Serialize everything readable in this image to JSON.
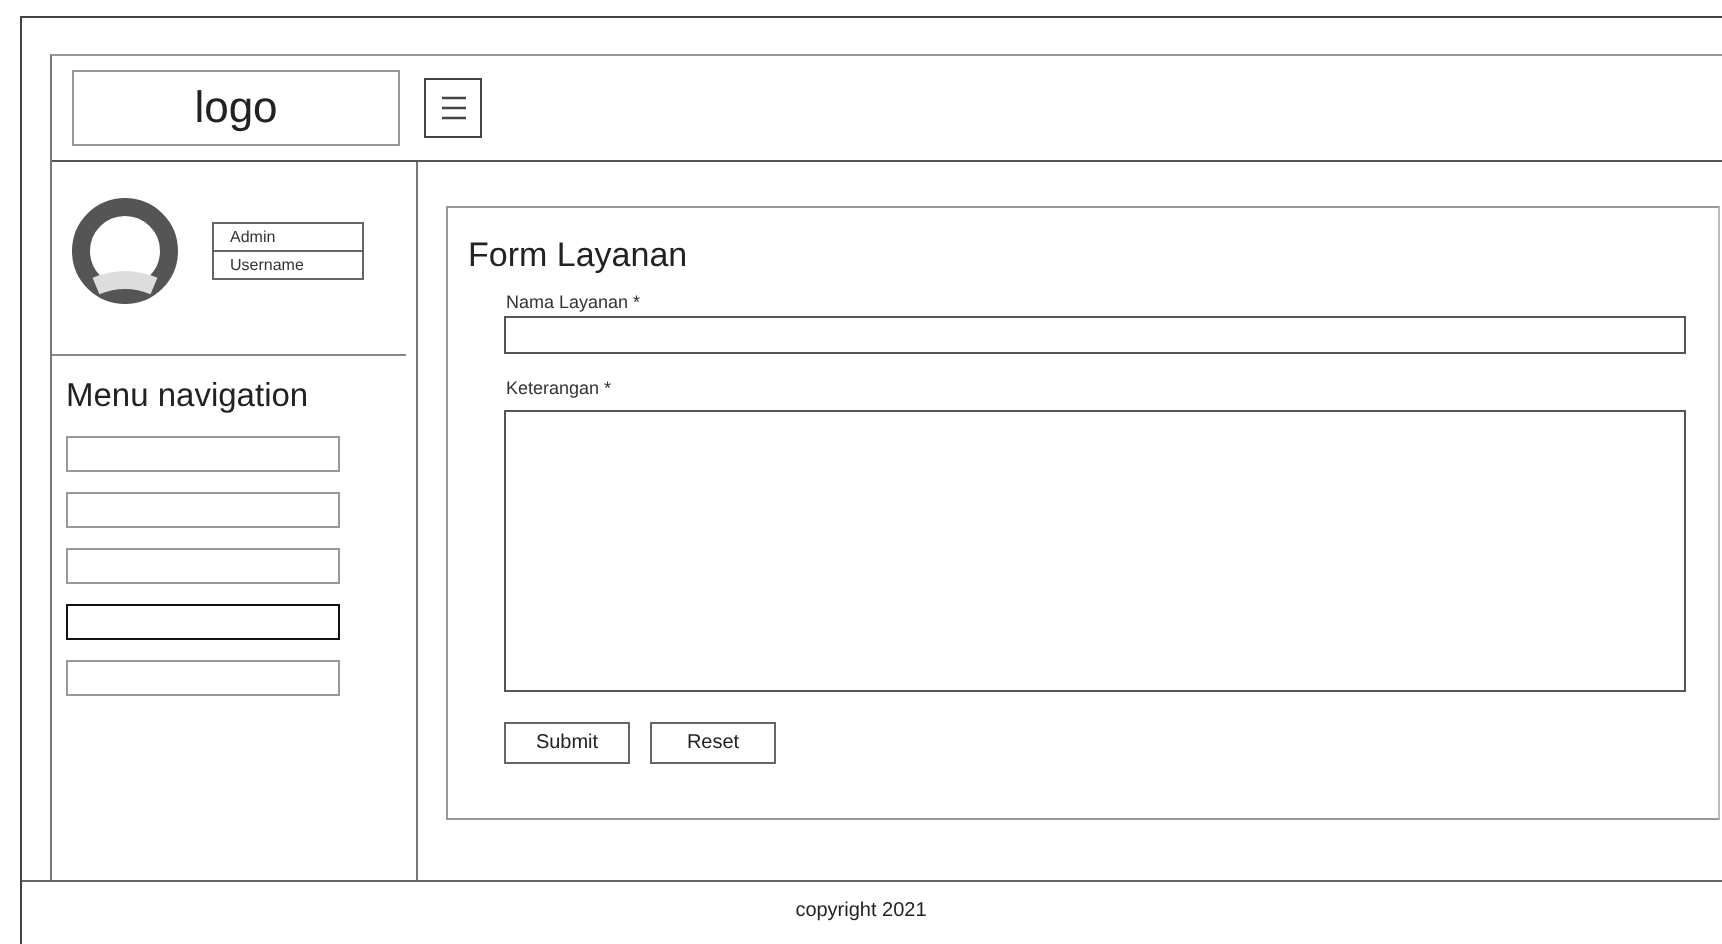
{
  "header": {
    "logo": "logo"
  },
  "profile": {
    "role": "Admin",
    "username": "Username"
  },
  "menu": {
    "title": "Menu navigation",
    "items": [
      {
        "selected": false
      },
      {
        "selected": false
      },
      {
        "selected": false
      },
      {
        "selected": true
      },
      {
        "selected": false
      }
    ]
  },
  "form": {
    "title": "Form Layanan",
    "fields": [
      {
        "kind": "input",
        "label": "Nama Layanan *"
      },
      {
        "kind": "textarea",
        "label": "Keterangan *"
      }
    ],
    "buttons": [
      "Submit",
      "Reset"
    ]
  },
  "footer": {
    "text": "copyright 2021"
  }
}
